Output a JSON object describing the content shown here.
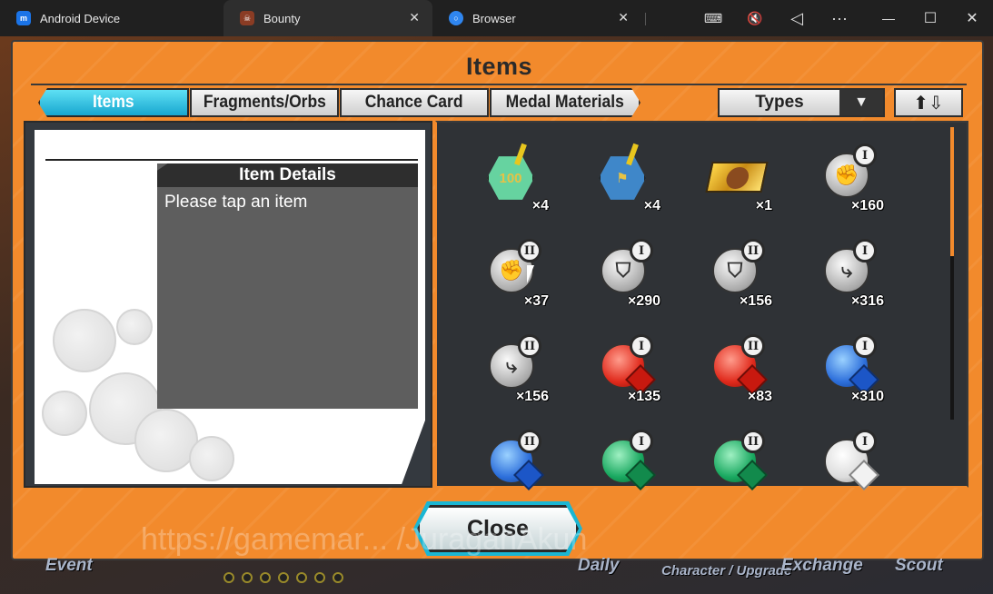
{
  "window": {
    "tabs": [
      {
        "label": "Android Device",
        "icon": "android-device-app-icon"
      },
      {
        "label": "Bounty",
        "icon": "bounty-game-icon"
      },
      {
        "label": "Browser",
        "icon": "browser-icon"
      }
    ],
    "controls": {
      "keyboard": "⌨",
      "mute": "🔇",
      "back": "◁",
      "more": "···",
      "minimize": "—",
      "maximize": "☐",
      "close": "✕"
    }
  },
  "panel": {
    "title": "Items",
    "tabs": [
      "Items",
      "Fragments/Orbs",
      "Chance Card",
      "Medal Materials"
    ],
    "active_tab": "Items",
    "types_label": "Types",
    "types_arrow": "▼",
    "sort_icons": "⬆⇩"
  },
  "details": {
    "heading": "Item Details",
    "placeholder": "Please tap an item"
  },
  "items": [
    {
      "kind": "medal-100",
      "quantity": "×4",
      "medal_text": "100",
      "color": "#66d3a0"
    },
    {
      "kind": "medal-flag",
      "quantity": "×4",
      "medal_text": "⚑",
      "color": "#3f87c9"
    },
    {
      "kind": "ticket",
      "quantity": "×1"
    },
    {
      "kind": "orb-fist",
      "quantity": "×160",
      "rank": "I",
      "glyph": "✊"
    },
    {
      "kind": "orb-fist",
      "quantity": "×37",
      "rank": "II",
      "glyph": "✊"
    },
    {
      "kind": "orb-shield",
      "quantity": "×290",
      "rank": "I",
      "glyph": "⛉"
    },
    {
      "kind": "orb-shield",
      "quantity": "×156",
      "rank": "II",
      "glyph": "⛉"
    },
    {
      "kind": "orb-boot",
      "quantity": "×316",
      "rank": "I",
      "glyph": "⤷"
    },
    {
      "kind": "orb-boot",
      "quantity": "×156",
      "rank": "II",
      "glyph": "⤷"
    },
    {
      "kind": "gem-red",
      "quantity": "×135",
      "rank": "I"
    },
    {
      "kind": "gem-red",
      "quantity": "×83",
      "rank": "II"
    },
    {
      "kind": "gem-blue",
      "quantity": "×310",
      "rank": "I"
    },
    {
      "kind": "gem-blue",
      "quantity": "",
      "rank": "II"
    },
    {
      "kind": "gem-green",
      "quantity": "",
      "rank": "I"
    },
    {
      "kind": "gem-green",
      "quantity": "",
      "rank": "II"
    },
    {
      "kind": "gem-white",
      "quantity": "",
      "rank": "I"
    }
  ],
  "close_label": "Close",
  "watermark": "https://gamemar... /JuraganAkun",
  "bottom_menu": [
    "Event",
    "Daily",
    "Character / Upgrade",
    "Exchange",
    "Scout"
  ],
  "colors": {
    "accent_orange": "#f28a2c",
    "tab_active": "#18a7cf",
    "frame_teal": "#1bb6d3"
  }
}
